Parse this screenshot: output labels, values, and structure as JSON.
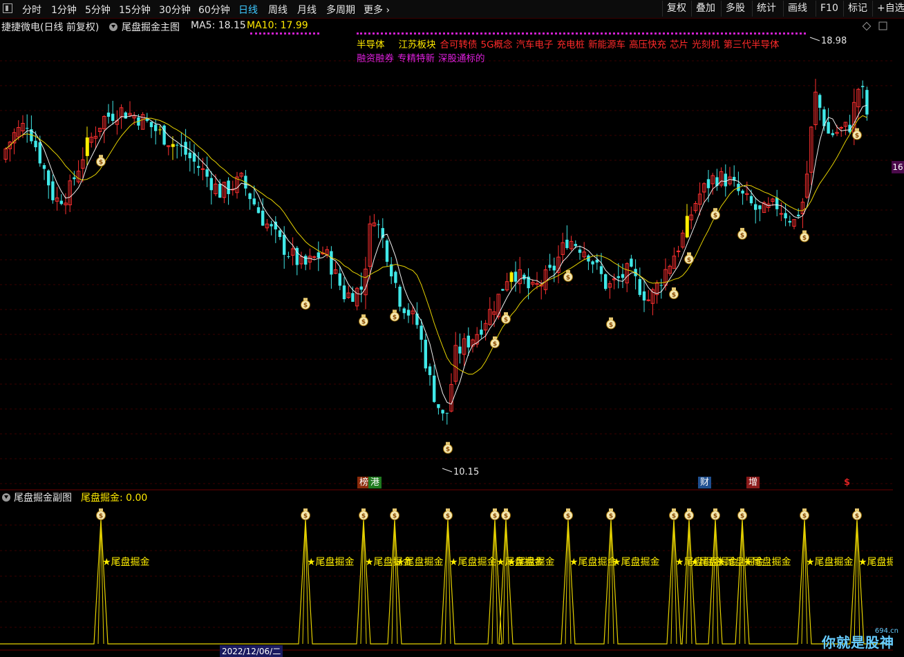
{
  "toolbar": {
    "periods": [
      "分时",
      "1分钟",
      "5分钟",
      "15分钟",
      "30分钟",
      "60分钟",
      "日线",
      "周线",
      "月线",
      "多周期",
      "更多"
    ],
    "active_period": "日线",
    "right_buttons": [
      "复权",
      "叠加",
      "多股",
      "统计",
      "画线",
      "F10",
      "标记",
      "+自选"
    ]
  },
  "info": {
    "stock": "捷捷微电(日线 前复权)",
    "indicator": "尾盘掘金主图",
    "ma5": "MA5: 18.15",
    "ma10": "MA10: 17.99"
  },
  "concepts": {
    "line1_yellow": [
      "半导体",
      "江苏板块"
    ],
    "line1_red": [
      "合可转债",
      "5G概念",
      "汽车电子",
      "充电桩",
      "新能源车",
      "高压快充",
      "芯片",
      "光刻机",
      "第三代半导体"
    ],
    "line2_magenta": [
      "融资融券",
      "专精特新",
      "深股通标的"
    ]
  },
  "price_labels": {
    "high": "18.98",
    "low": "10.15"
  },
  "right_tag": "16",
  "badges": [
    {
      "text": "榜",
      "color": "#8b2a0a"
    },
    {
      "text": "港",
      "color": "#1f7a1f"
    },
    {
      "text": "财",
      "color": "#1f4f8f"
    },
    {
      "text": "增",
      "color": "#8b1a1a"
    },
    {
      "text": "$",
      "color": "#d22"
    }
  ],
  "sub": {
    "title": "尾盘掘金副图",
    "value": "尾盘掘金: 0.00",
    "signal_label": "★尾盘掘金"
  },
  "bottom_date": "2022/12/06/二",
  "watermark": {
    "text": "你就是股神",
    "site": "694.cn"
  },
  "chart_data": {
    "type": "candlestick",
    "price_range": [
      9.5,
      20.2
    ],
    "signal_count": 20
  }
}
